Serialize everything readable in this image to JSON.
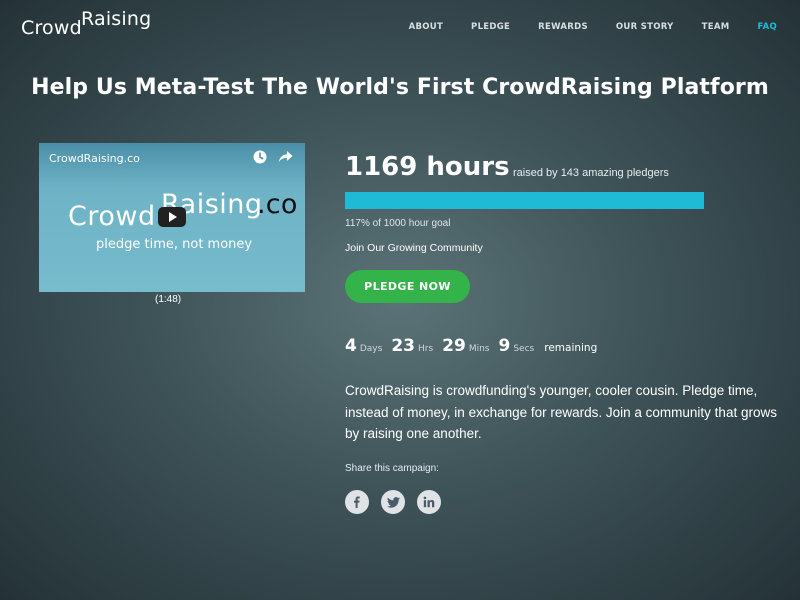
{
  "logo": {
    "part1": "Crowd",
    "part2": "Raising"
  },
  "nav": {
    "items": [
      {
        "label": "ABOUT"
      },
      {
        "label": "PLEDGE"
      },
      {
        "label": "REWARDS"
      },
      {
        "label": "OUR STORY"
      },
      {
        "label": "TEAM"
      },
      {
        "label": "FAQ"
      }
    ],
    "active_color": "#20bcd6"
  },
  "page_title": "Help Us Meta-Test The World's First CrowdRaising Platform",
  "video": {
    "title": "CrowdRaising.co",
    "brand_part1": "Crowd",
    "brand_part2": "Raising",
    "brand_part3": ".co",
    "tagline": "pledge time, not money",
    "duration": "(1:48)",
    "icons": [
      "clock-icon",
      "share-arrow-icon",
      "play-icon"
    ]
  },
  "campaign": {
    "hours": "1169 hours",
    "raised_by": "raised by 143 amazing pledgers",
    "progress_percent": 100,
    "goal_text": "117% of 1000 hour goal",
    "community_link": "Join Our Growing Community",
    "pledge_button": "PLEDGE NOW",
    "pledge_color": "#33b34a",
    "progress_color": "#1fbad6"
  },
  "countdown": {
    "days": "4",
    "days_label": "Days",
    "hours": "23",
    "hours_label": "Hrs",
    "minutes": "29",
    "minutes_label": "Mins",
    "seconds": "9",
    "seconds_label": "Secs",
    "remaining_label": "remaining"
  },
  "description": "CrowdRaising is crowdfunding's younger, cooler cousin. Pledge time, instead of money, in exchange for rewards. Join a community that grows by raising one another.",
  "share": {
    "label": "Share this campaign:",
    "icons": [
      "facebook-icon",
      "twitter-icon",
      "linkedin-icon"
    ]
  }
}
